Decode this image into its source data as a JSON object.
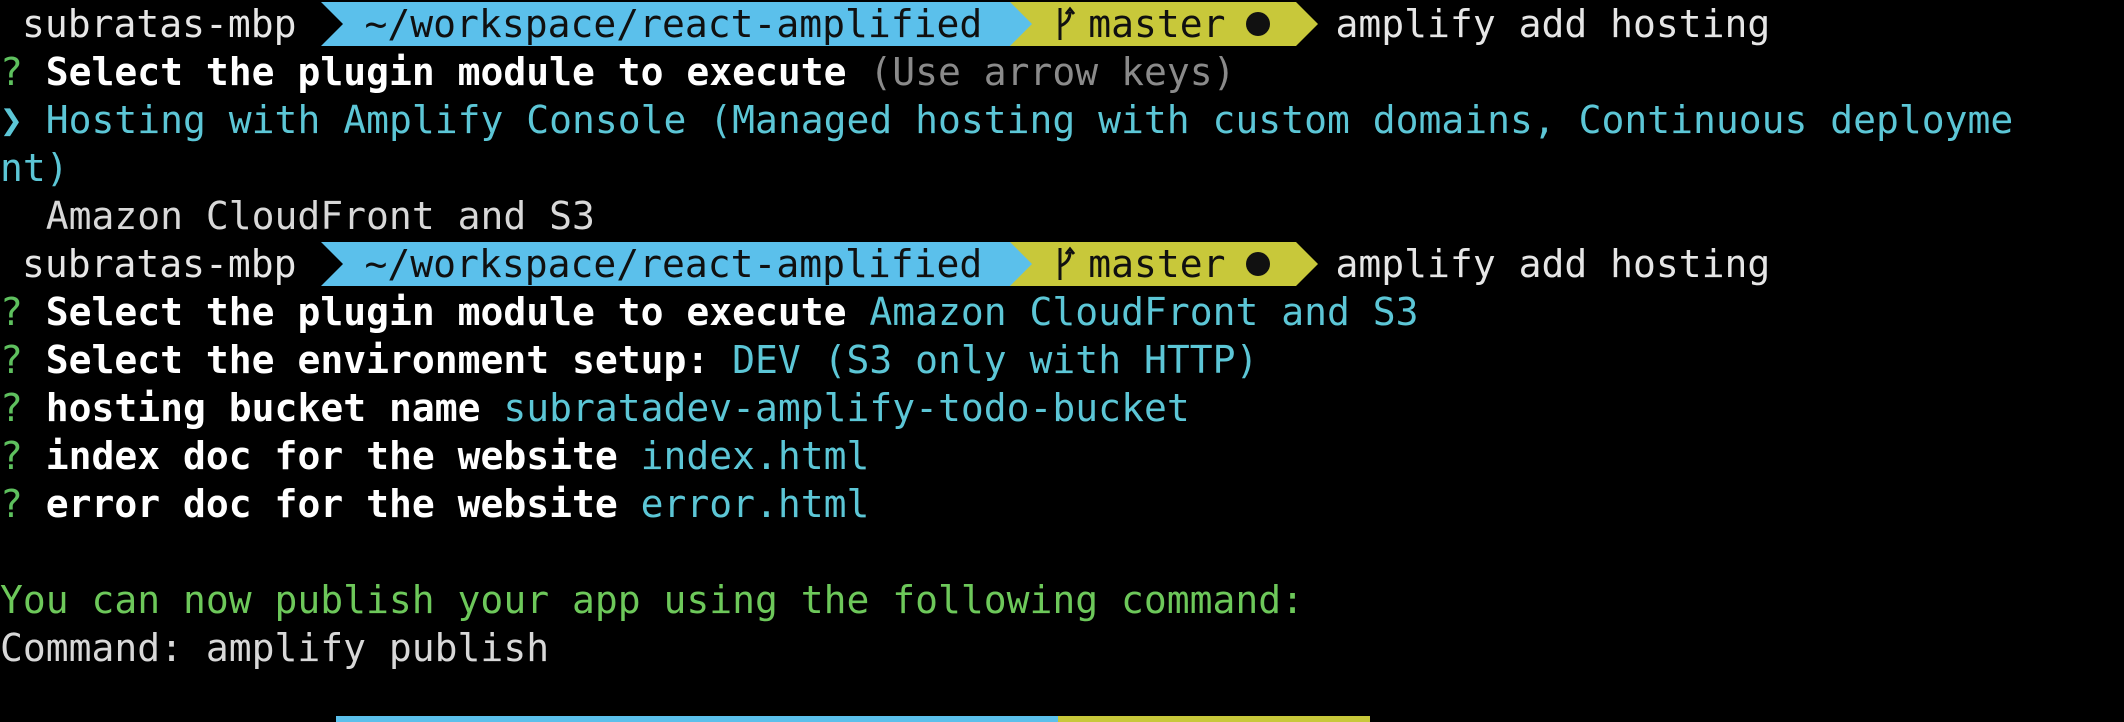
{
  "prompt": {
    "host": "subratas-mbp",
    "path": "~/workspace/react-amplified",
    "branch": "master",
    "colors": {
      "path_bg": "#5bc0eb",
      "git_bg": "#c8c83a",
      "host_fg": "#e6e6e6"
    }
  },
  "session1": {
    "command": "amplify add hosting",
    "question_mark": "?",
    "question": "Select the plugin module to execute",
    "hint": "(Use arrow keys)",
    "pointer": "❯",
    "option_selected_line1": "Hosting with Amplify Console (Managed hosting with custom domains, Continuous deployme",
    "option_selected_line2": "nt)",
    "option_other": "Amazon CloudFront and S3"
  },
  "session2": {
    "command": "amplify add hosting",
    "q1_label": "Select the plugin module to execute",
    "q1_answer": "Amazon CloudFront and S3",
    "q2_label": "Select the environment setup:",
    "q2_answer": "DEV (S3 only with HTTP)",
    "q3_label": "hosting bucket name",
    "q3_answer": "subratadev-amplify-todo-bucket",
    "q4_label": "index doc for the website",
    "q4_answer": "index.html",
    "q5_label": "error doc for the website",
    "q5_answer": "error.html",
    "success_message": "You can now publish your app using the following command:",
    "command_hint": "Command: amplify publish"
  }
}
